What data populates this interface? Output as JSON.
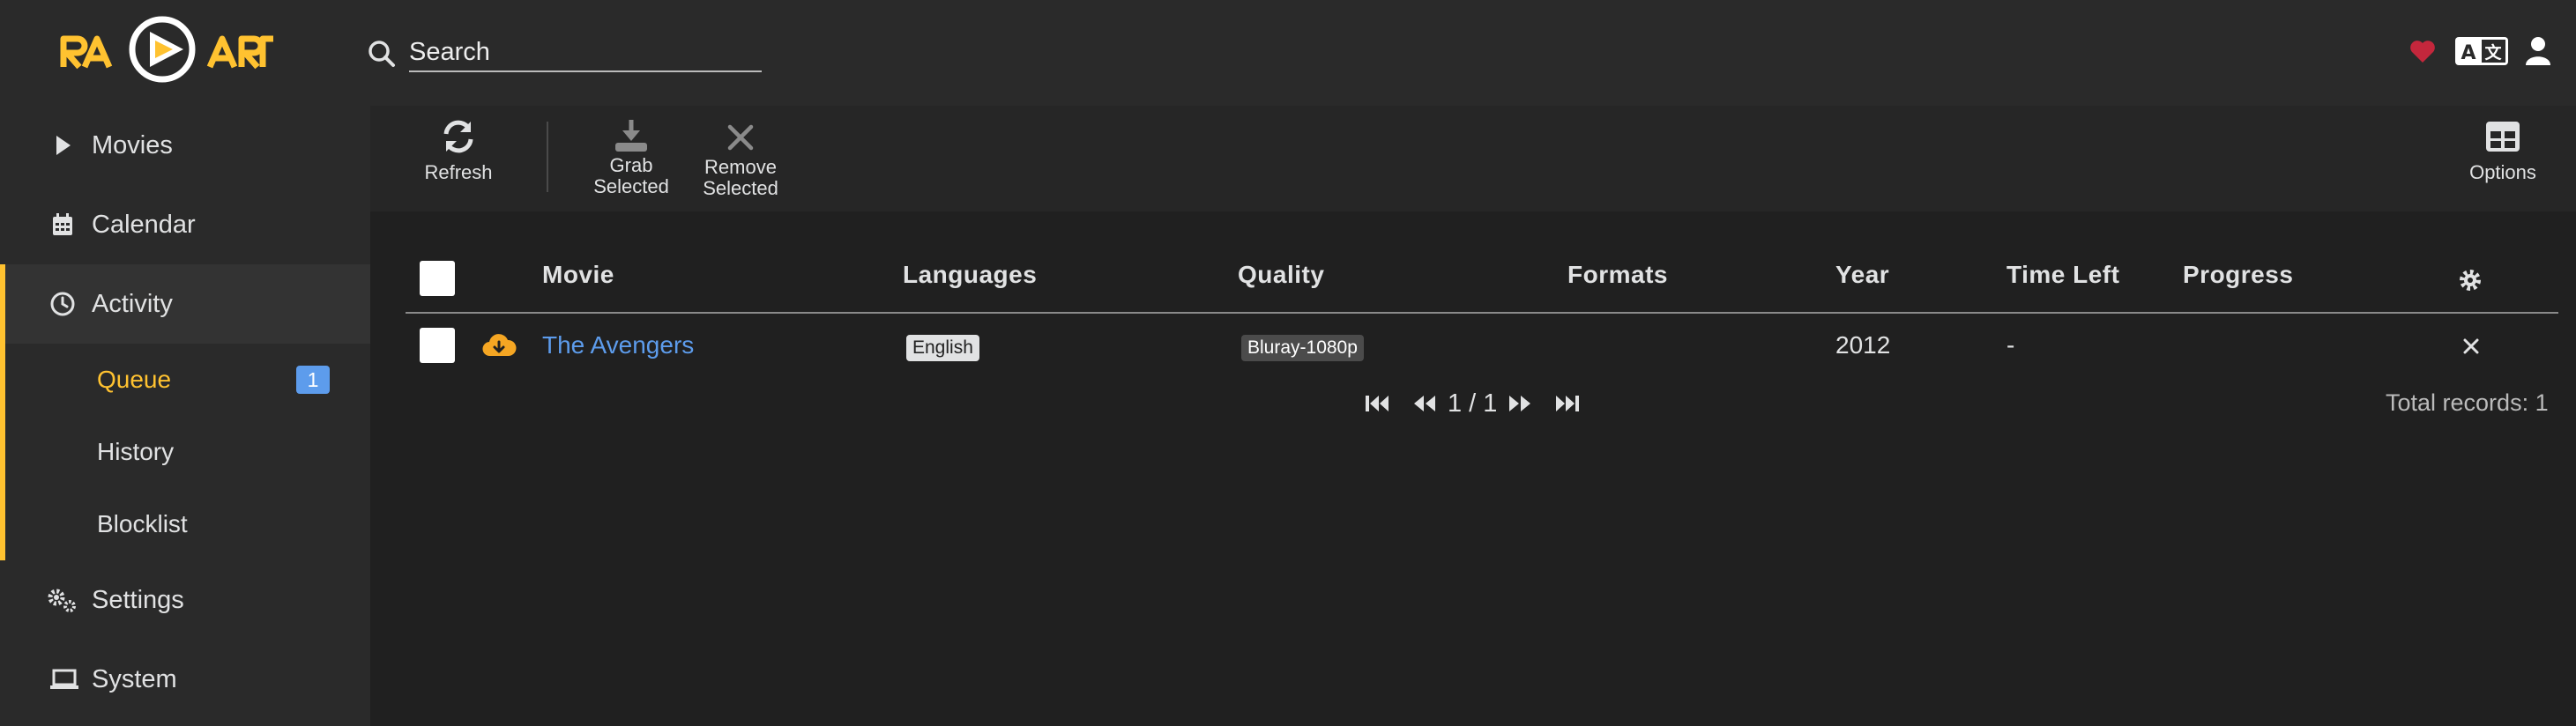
{
  "header": {
    "search": {
      "placeholder": "Search",
      "value": ""
    },
    "icons": [
      "heart-icon",
      "translate-icon",
      "user-icon"
    ],
    "colors": {
      "accent": "#ffc230",
      "heart": "#c4273c"
    }
  },
  "sidebar": {
    "items": [
      {
        "label": "Movies",
        "icon": "play-icon"
      },
      {
        "label": "Calendar",
        "icon": "calendar-icon"
      },
      {
        "label": "Activity",
        "icon": "clock-icon"
      },
      {
        "label": "Settings",
        "icon": "cogs-icon"
      },
      {
        "label": "System",
        "icon": "laptop-icon"
      }
    ],
    "subitems": [
      {
        "label": "Queue",
        "badge": "1"
      },
      {
        "label": "History"
      },
      {
        "label": "Blocklist"
      }
    ]
  },
  "toolbar": {
    "refresh_label": "Refresh",
    "grab_label_1": "Grab",
    "grab_label_2": "Selected",
    "remove_label_1": "Remove",
    "remove_label_2": "Selected",
    "options_label": "Options"
  },
  "table": {
    "columns": [
      "Movie",
      "Languages",
      "Quality",
      "Formats",
      "Year",
      "Time Left",
      "Progress"
    ],
    "rows": [
      {
        "movie": "The Avengers",
        "language": "English",
        "quality": "Bluray-1080p",
        "formats": "",
        "year": "2012",
        "time_left": "-",
        "progress": ""
      }
    ]
  },
  "pager": {
    "page": "1 / 1",
    "total": "Total records: 1"
  }
}
